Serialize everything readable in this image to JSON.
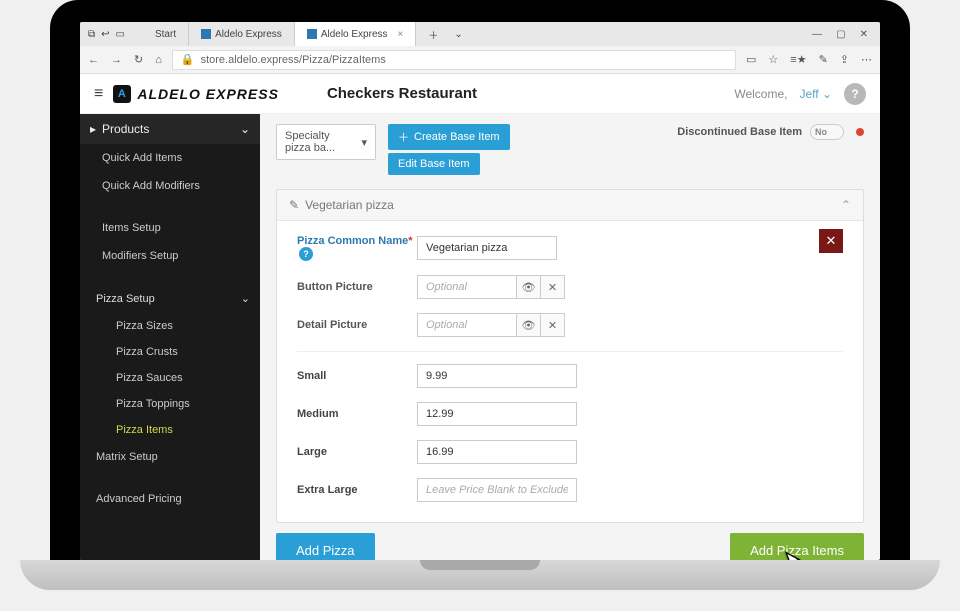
{
  "browser": {
    "start_label": "Start",
    "tabs": [
      {
        "label": "Aldelo Express",
        "active": false
      },
      {
        "label": "Aldelo Express",
        "active": true
      }
    ],
    "url": "store.aldelo.express/Pizza/PizzaItems"
  },
  "header": {
    "brand": "ALDELO EXPRESS",
    "page_title": "Checkers Restaurant",
    "welcome": "Welcome,",
    "user": "Jeff"
  },
  "sidebar": {
    "section": "Products",
    "items": [
      "Quick Add Items",
      "Quick Add Modifiers",
      "Items Setup",
      "Modifiers Setup"
    ],
    "pizza_section": "Pizza Setup",
    "pizza_items": [
      "Pizza Sizes",
      "Pizza Crusts",
      "Pizza Sauces",
      "Pizza Toppings",
      "Pizza Items"
    ],
    "matrix": "Matrix Setup",
    "advanced": "Advanced Pricing"
  },
  "topbar": {
    "select_value": "Specialty pizza ba...",
    "create_base": "Create Base Item",
    "edit_base": "Edit Base Item",
    "discontinued_label": "Discontinued Base Item",
    "discontinued_value": "No"
  },
  "panel": {
    "title": "Vegetarian pizza",
    "common_name_label": "Pizza Common Name",
    "common_name_ast": "*",
    "common_name_value": "Vegetarian pizza",
    "button_picture_label": "Button Picture",
    "detail_picture_label": "Detail Picture",
    "optional_placeholder": "Optional",
    "sizes": {
      "small_label": "Small",
      "small_value": "9.99",
      "medium_label": "Medium",
      "medium_value": "12.99",
      "large_label": "Large",
      "large_value": "16.99",
      "xlarge_label": "Extra Large",
      "xlarge_placeholder": "Leave Price Blank to Exclude"
    }
  },
  "footer": {
    "add_pizza": "Add Pizza",
    "add_pizza_items": "Add Pizza Items"
  }
}
